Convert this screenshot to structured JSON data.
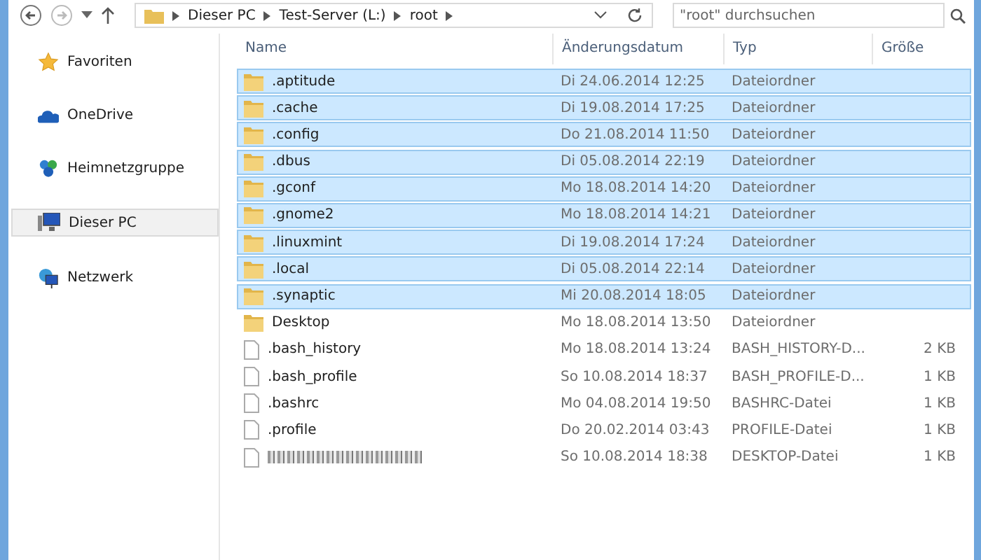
{
  "address_bar": {
    "breadcrumbs": [
      "Dieser PC",
      "Test-Server (L:)",
      "root"
    ]
  },
  "search": {
    "placeholder": "\"root\" durchsuchen"
  },
  "sidebar": {
    "items": [
      {
        "label": "Favoriten",
        "selected": false
      },
      {
        "label": "OneDrive",
        "selected": false
      },
      {
        "label": "Heimnetzgruppe",
        "selected": false
      },
      {
        "label": "Dieser PC",
        "selected": true
      },
      {
        "label": "Netzwerk",
        "selected": false
      }
    ]
  },
  "table": {
    "columns": [
      "Name",
      "Änderungsdatum",
      "Typ",
      "Größe"
    ],
    "rows": [
      {
        "kind": "folder",
        "name": ".aptitude",
        "date": "Di 24.06.2014 12:25",
        "type": "Dateiordner",
        "selected": true
      },
      {
        "kind": "folder",
        "name": ".cache",
        "date": "Di 19.08.2014 17:25",
        "type": "Dateiordner",
        "selected": true
      },
      {
        "kind": "folder",
        "name": ".config",
        "date": "Do 21.08.2014 11:50",
        "type": "Dateiordner",
        "selected": true
      },
      {
        "kind": "folder",
        "name": ".dbus",
        "date": "Di 05.08.2014 22:19",
        "type": "Dateiordner",
        "selected": true
      },
      {
        "kind": "folder",
        "name": ".gconf",
        "date": "Mo 18.08.2014 14:20",
        "type": "Dateiordner",
        "selected": true
      },
      {
        "kind": "folder",
        "name": ".gnome2",
        "date": "Mo 18.08.2014 14:21",
        "type": "Dateiordner",
        "selected": true
      },
      {
        "kind": "folder",
        "name": ".linuxmint",
        "date": "Di 19.08.2014 17:24",
        "type": "Dateiordner",
        "selected": true
      },
      {
        "kind": "folder",
        "name": ".local",
        "date": "Di 05.08.2014 22:14",
        "type": "Dateiordner",
        "selected": true
      },
      {
        "kind": "folder",
        "name": ".synaptic",
        "date": "Mi 20.08.2014 18:05",
        "type": "Dateiordner",
        "selected": true
      },
      {
        "kind": "folder",
        "name": "Desktop",
        "date": "Mo 18.08.2014 13:50",
        "type": "Dateiordner",
        "selected": false
      },
      {
        "kind": "file",
        "name": ".bash_history",
        "date": "Mo 18.08.2014 13:24",
        "type": "BASH_HISTORY-D...",
        "size": "2 KB",
        "selected": false
      },
      {
        "kind": "file",
        "name": ".bash_profile",
        "date": "So 10.08.2014 18:37",
        "type": "BASH_PROFILE-D...",
        "size": "1 KB",
        "selected": false
      },
      {
        "kind": "file",
        "name": ".bashrc",
        "date": "Mo 04.08.2014 19:50",
        "type": "BASHRC-Datei",
        "size": "1 KB",
        "selected": false
      },
      {
        "kind": "file",
        "name": ".profile",
        "date": "Do 20.02.2014 03:43",
        "type": "PROFILE-Datei",
        "size": "1 KB",
        "selected": false
      },
      {
        "kind": "obscured-file",
        "date": "So 10.08.2014 18:38",
        "type": "DESKTOP-Datei",
        "size": "1 KB",
        "selected": false
      }
    ]
  }
}
